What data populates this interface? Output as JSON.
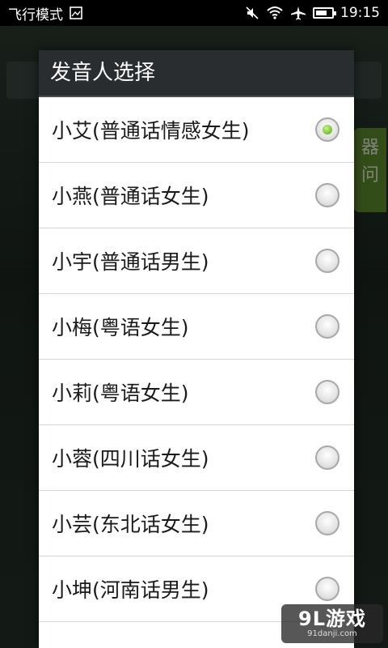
{
  "status_bar": {
    "mode_label": "飞行模式",
    "time": "19:15"
  },
  "background_app": {
    "side_button_chars": [
      "器",
      "问"
    ]
  },
  "dialog": {
    "title": "发音人选择",
    "options": [
      {
        "label": "小艾(普通话情感女生)",
        "checked": true
      },
      {
        "label": "小燕(普通话女生)",
        "checked": false
      },
      {
        "label": "小宇(普通话男生)",
        "checked": false
      },
      {
        "label": "小梅(粤语女生)",
        "checked": false
      },
      {
        "label": "小莉(粤语女生)",
        "checked": false
      },
      {
        "label": "小蓉(四川话女生)",
        "checked": false
      },
      {
        "label": "小芸(东北话女生)",
        "checked": false
      },
      {
        "label": "小坤(河南话男生)",
        "checked": false
      }
    ]
  },
  "watermark": {
    "main": "9L游戏",
    "sub": "91danji.com"
  },
  "colors": {
    "dialog_header_bg": "#2a2d30",
    "radio_checked": "#7cc63a",
    "side_button": "#5e8c2e"
  }
}
